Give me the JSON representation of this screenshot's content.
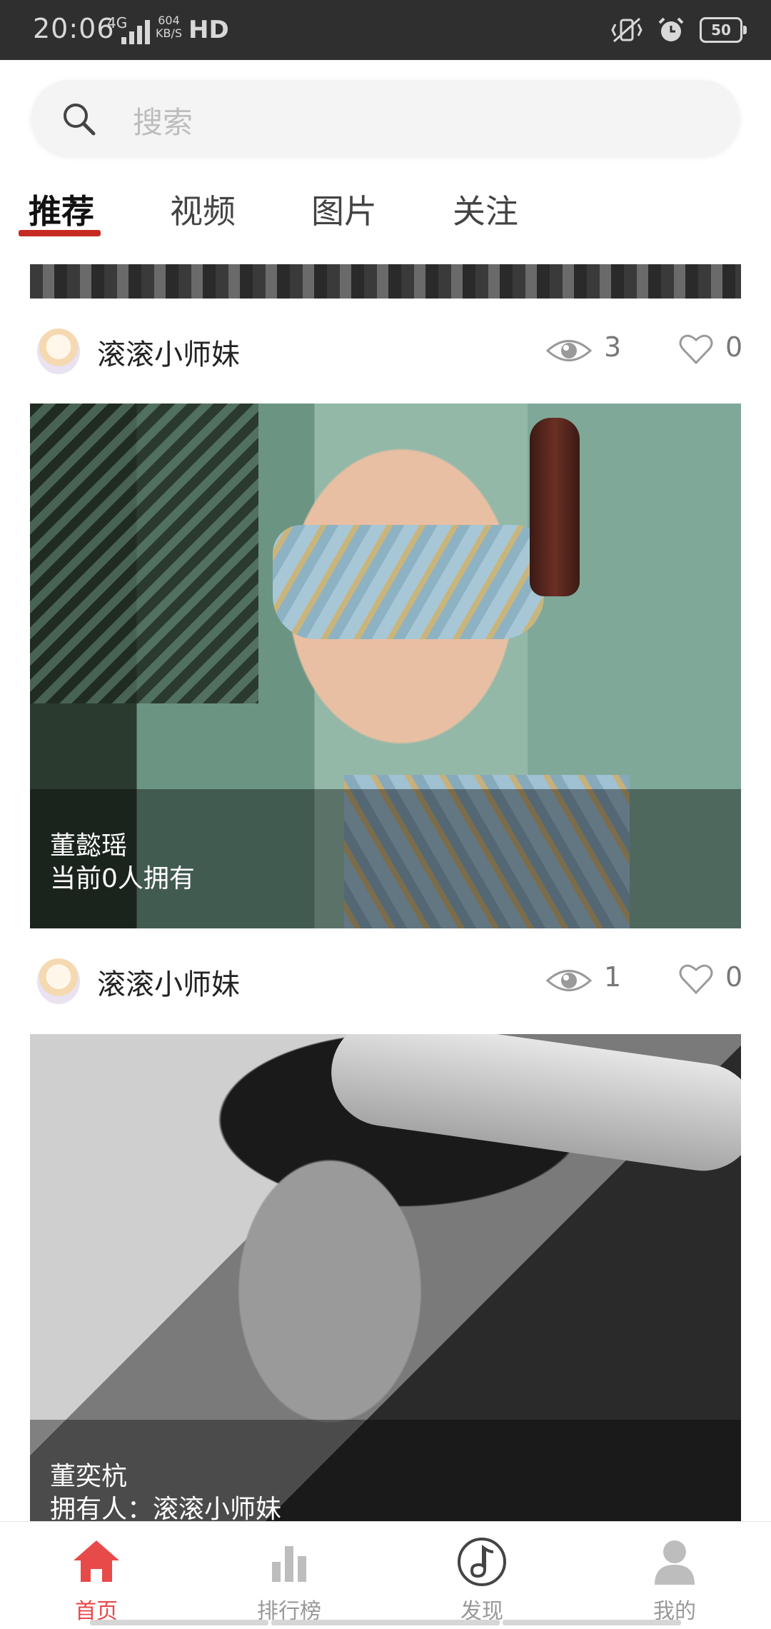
{
  "status_bar": {
    "time": "20:06",
    "network": "4G",
    "speed_value": "604",
    "speed_unit": "KB/S",
    "hd": "HD",
    "battery": "50"
  },
  "search": {
    "placeholder": "搜索"
  },
  "tabs": [
    {
      "label": "推荐",
      "active": true
    },
    {
      "label": "视频",
      "active": false
    },
    {
      "label": "图片",
      "active": false
    },
    {
      "label": "关注",
      "active": false
    }
  ],
  "posts": [
    {
      "username": "滚滚小师妹",
      "views": "3",
      "likes": "0",
      "caption_title": "董懿瑶",
      "caption_subtitle": "当前0人拥有"
    },
    {
      "username": "滚滚小师妹",
      "views": "1",
      "likes": "0",
      "caption_title": "董奕杭",
      "caption_subtitle": "拥有人：滚滚小师妹"
    }
  ],
  "bottom_nav": [
    {
      "label": "首页",
      "icon": "home-icon",
      "active": true
    },
    {
      "label": "排行榜",
      "icon": "ranking-icon",
      "active": false
    },
    {
      "label": "发现",
      "icon": "music-note-icon",
      "active": false
    },
    {
      "label": "我的",
      "icon": "user-icon",
      "active": false
    }
  ],
  "colors": {
    "accent": "#e84a4a",
    "tab_underline": "#c62b23",
    "status_bar_bg": "#2f2f2f"
  }
}
